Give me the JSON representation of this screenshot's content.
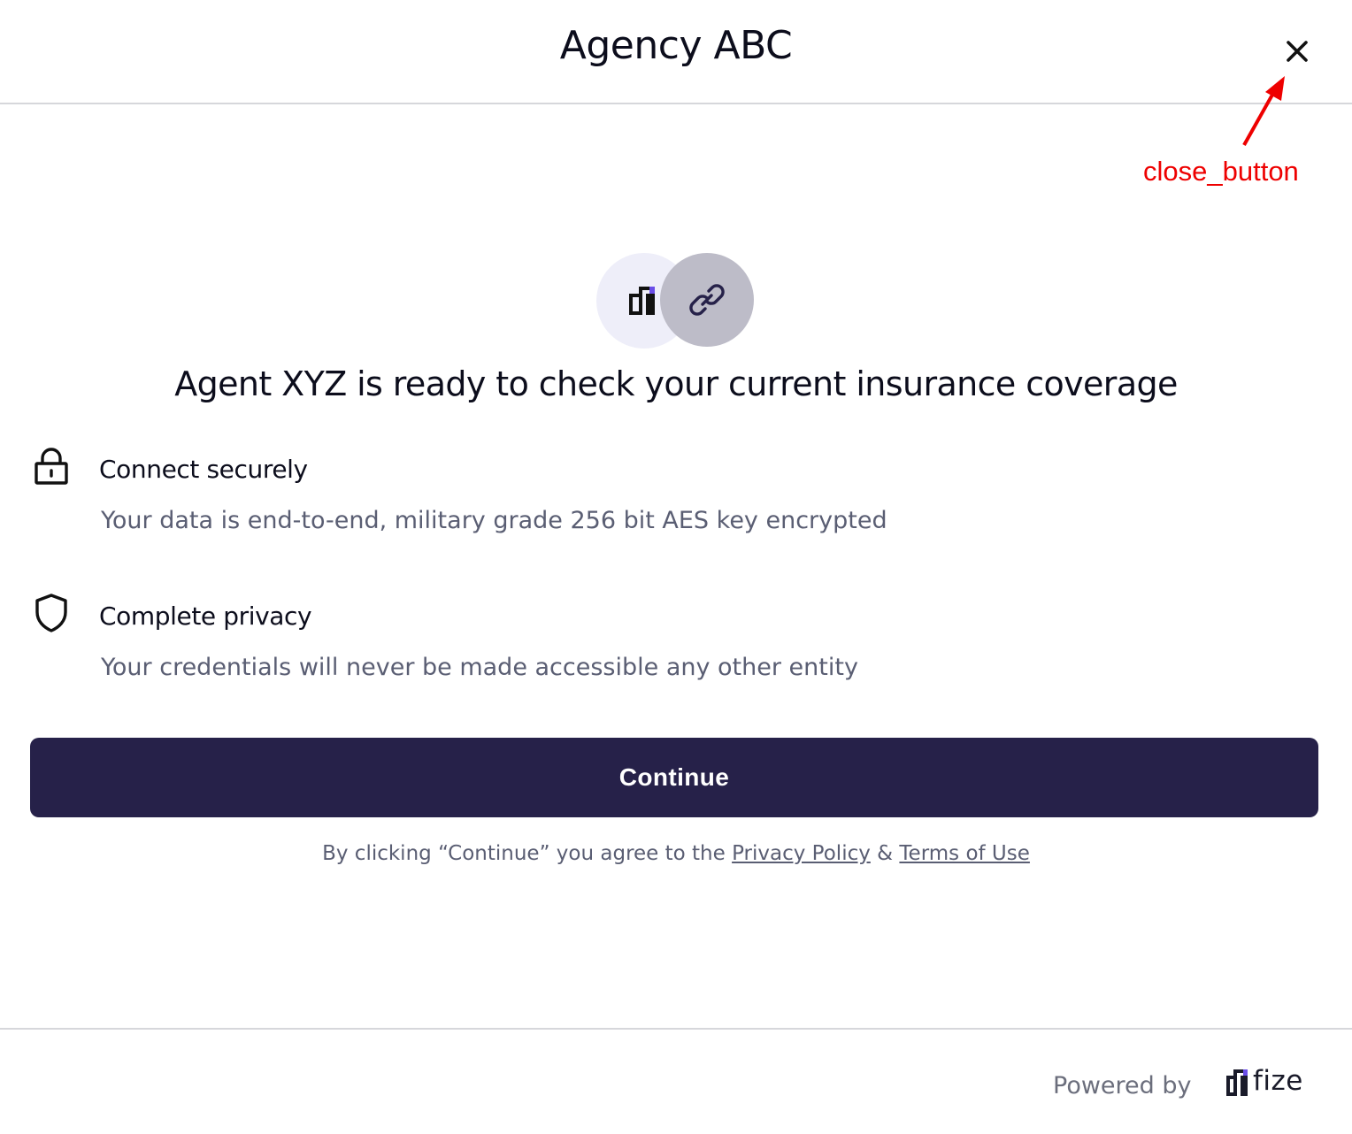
{
  "header": {
    "title": "Agency ABC",
    "close_icon": "close-icon"
  },
  "annotation": {
    "label": "close_button",
    "color": "#ee0000"
  },
  "hero": {
    "left_icon": "fize-logo-icon",
    "right_icon": "link-icon",
    "headline": "Agent XYZ is ready to check your current insurance coverage"
  },
  "features": [
    {
      "icon": "lock-icon",
      "title": "Connect securely",
      "description": "Your data is end-to-end, military grade 256 bit AES key encrypted"
    },
    {
      "icon": "shield-icon",
      "title": "Complete privacy",
      "description": "Your credentials will never be made accessible any other entity"
    }
  ],
  "continue_button": {
    "label": "Continue",
    "color": "#262149"
  },
  "consent": {
    "prefix": "By clicking “Continue” you agree to the ",
    "privacy_link": "Privacy Policy",
    "separator": " & ",
    "terms_link": "Terms of Use"
  },
  "footer": {
    "powered_by": "Powered by",
    "brand": "fize",
    "brand_icon": "fize-logo-icon"
  }
}
